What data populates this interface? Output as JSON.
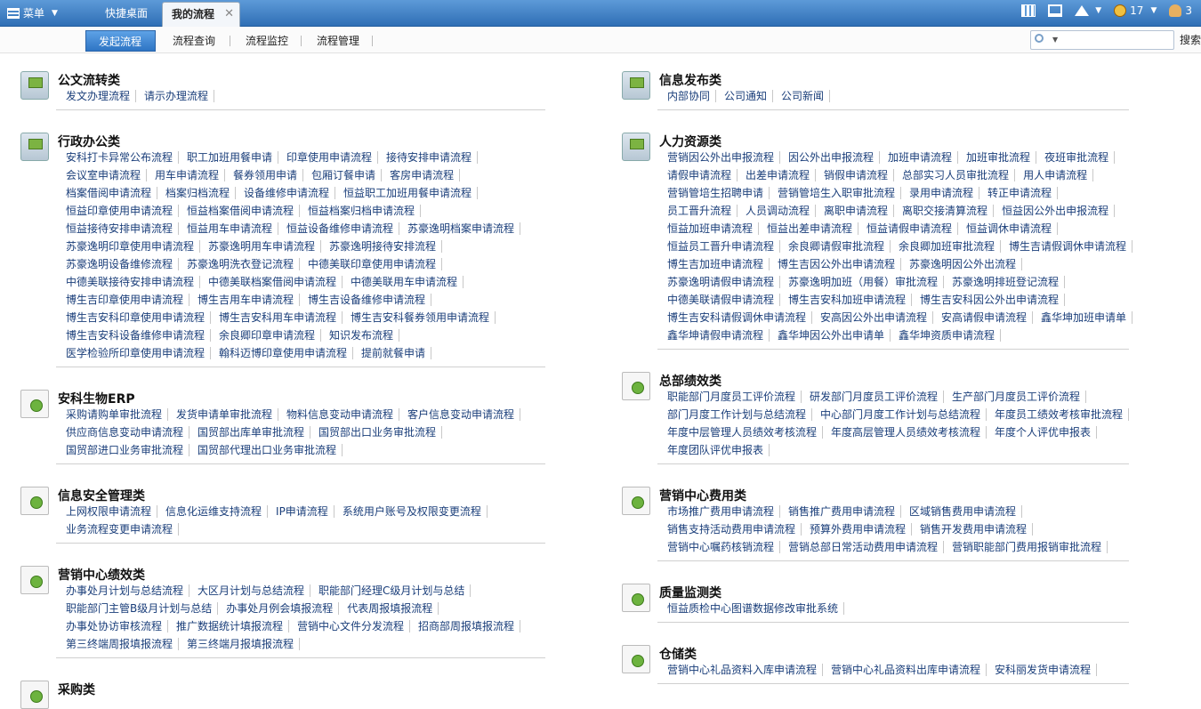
{
  "topbar": {
    "menu_label": "菜单",
    "tabs": [
      {
        "label": "快捷桌面"
      },
      {
        "label": "我的流程"
      }
    ],
    "notice_count": "17",
    "user_count": "3"
  },
  "subnav": {
    "tabs": [
      "发起流程",
      "流程查询",
      "流程监控",
      "流程管理"
    ],
    "search_button": "搜索",
    "search_placeholder": ""
  },
  "left_sections": [
    {
      "title": "公文流转类",
      "icon": "network-icon",
      "rows": [
        [
          "发文办理流程",
          "请示办理流程"
        ]
      ]
    },
    {
      "title": "行政办公类",
      "icon": "network-icon",
      "rows": [
        [
          "安科打卡异常公布流程",
          "职工加班用餐申请",
          "印章使用申请流程",
          "接待安排申请流程"
        ],
        [
          "会议室申请流程",
          "用车申请流程",
          "餐券领用申请",
          "包厢订餐申请",
          "客房申请流程"
        ],
        [
          "档案借阅申请流程",
          "档案归档流程",
          "设备维修申请流程",
          "恒益职工加班用餐申请流程"
        ],
        [
          "恒益印章使用申请流程",
          "恒益档案借阅申请流程",
          "恒益档案归档申请流程"
        ],
        [
          "恒益接待安排申请流程",
          "恒益用车申请流程",
          "恒益设备维修申请流程",
          "苏豪逸明档案申请流程"
        ],
        [
          "苏豪逸明印章使用申请流程",
          "苏豪逸明用车申请流程",
          "苏豪逸明接待安排流程"
        ],
        [
          "苏豪逸明设备维修流程",
          "苏豪逸明洗衣登记流程",
          "中德美联印章使用申请流程"
        ],
        [
          "中德美联接待安排申请流程",
          "中德美联档案借阅申请流程",
          "中德美联用车申请流程"
        ],
        [
          "博生吉印章使用申请流程",
          "博生吉用车申请流程",
          "博生吉设备维修申请流程"
        ],
        [
          "博生吉安科印章使用申请流程",
          "博生吉安科用车申请流程",
          "博生吉安科餐券领用申请流程"
        ],
        [
          "博生吉安科设备维修申请流程",
          "余良卿印章申请流程",
          "知识发布流程"
        ],
        [
          "医学检验所印章使用申请流程",
          "翰科迈博印章使用申请流程",
          "提前就餐申请"
        ]
      ]
    },
    {
      "title": "安科生物ERP",
      "icon": "document-icon",
      "rows": [
        [
          "采购请购单审批流程",
          "发货申请单审批流程",
          "物料信息变动申请流程",
          "客户信息变动申请流程"
        ],
        [
          "供应商信息变动申请流程",
          "国贸部出库单审批流程",
          "国贸部出口业务审批流程"
        ],
        [
          "国贸部进口业务审批流程",
          "国贸部代理出口业务审批流程"
        ]
      ]
    },
    {
      "title": "信息安全管理类",
      "icon": "document-icon",
      "rows": [
        [
          "上网权限申请流程",
          "信息化运维支持流程",
          "IP申请流程",
          "系统用户账号及权限变更流程"
        ],
        [
          "业务流程变更申请流程"
        ]
      ]
    },
    {
      "title": "营销中心绩效类",
      "icon": "document-icon",
      "rows": [
        [
          "办事处月计划与总结流程",
          "大区月计划与总结流程",
          "职能部门经理C级月计划与总结"
        ],
        [
          "职能部门主管B级月计划与总结",
          "办事处月例会填报流程",
          "代表周报填报流程"
        ],
        [
          "办事处协访审核流程",
          "推广数据统计填报流程",
          "营销中心文件分发流程",
          "招商部周报填报流程"
        ],
        [
          "第三终端周报填报流程",
          "第三终端月报填报流程"
        ]
      ]
    },
    {
      "title": "采购类",
      "icon": "document-icon",
      "rows": []
    }
  ],
  "right_sections": [
    {
      "title": "信息发布类",
      "icon": "network-icon",
      "rows": [
        [
          "内部协同",
          "公司通知",
          "公司新闻"
        ]
      ]
    },
    {
      "title": "人力资源类",
      "icon": "network-icon",
      "rows": [
        [
          "营销因公外出申报流程",
          "因公外出申报流程",
          "加班申请流程",
          "加班审批流程",
          "夜班审批流程"
        ],
        [
          "请假申请流程",
          "出差申请流程",
          "销假申请流程",
          "总部实习人员审批流程",
          "用人申请流程"
        ],
        [
          "营销管培生招聘申请",
          "营销管培生入职审批流程",
          "录用申请流程",
          "转正申请流程"
        ],
        [
          "员工晋升流程",
          "人员调动流程",
          "离职申请流程",
          "离职交接清算流程",
          "恒益因公外出申报流程"
        ],
        [
          "恒益加班申请流程",
          "恒益出差申请流程",
          "恒益请假申请流程",
          "恒益调休申请流程"
        ],
        [
          "恒益员工晋升申请流程",
          "余良卿请假审批流程",
          "余良卿加班审批流程",
          "博生吉请假调休申请流程"
        ],
        [
          "博生吉加班申请流程",
          "博生吉因公外出申请流程",
          "苏豪逸明因公外出流程"
        ],
        [
          "苏豪逸明请假申请流程",
          "苏豪逸明加班（用餐）审批流程",
          "苏豪逸明排班登记流程"
        ],
        [
          "中德美联请假申请流程",
          "博生吉安科加班申请流程",
          "博生吉安科因公外出申请流程"
        ],
        [
          "博生吉安科请假调休申请流程",
          "安高因公外出申请流程",
          "安高请假申请流程",
          "鑫华坤加班申请单"
        ],
        [
          "鑫华坤请假申请流程",
          "鑫华坤因公外出申请单",
          "鑫华坤资质申请流程"
        ]
      ]
    },
    {
      "title": "总部绩效类",
      "icon": "document-icon",
      "rows": [
        [
          "职能部门月度员工评价流程",
          "研发部门月度员工评价流程",
          "生产部门月度员工评价流程"
        ],
        [
          "部门月度工作计划与总结流程",
          "中心部门月度工作计划与总结流程",
          "年度员工绩效考核审批流程"
        ],
        [
          "年度中层管理人员绩效考核流程",
          "年度高层管理人员绩效考核流程",
          "年度个人评优申报表"
        ],
        [
          "年度团队评优申报表"
        ]
      ]
    },
    {
      "title": "营销中心费用类",
      "icon": "document-icon",
      "rows": [
        [
          "市场推广费用申请流程",
          "销售推广费用申请流程",
          "区域销售费用申请流程"
        ],
        [
          "销售支持活动费用申请流程",
          "预算外费用申请流程",
          "销售开发费用申请流程"
        ],
        [
          "营销中心嘱药核销流程",
          "营销总部日常活动费用申请流程",
          "营销职能部门费用报销审批流程"
        ]
      ]
    },
    {
      "title": "质量监测类",
      "icon": "document-icon",
      "rows": [
        [
          "恒益质检中心图谱数据修改审批系统"
        ]
      ]
    },
    {
      "title": "仓储类",
      "icon": "document-icon",
      "rows": [
        [
          "营销中心礼品资料入库申请流程",
          "营销中心礼品资料出库申请流程",
          "安科丽发货申请流程"
        ]
      ]
    }
  ]
}
